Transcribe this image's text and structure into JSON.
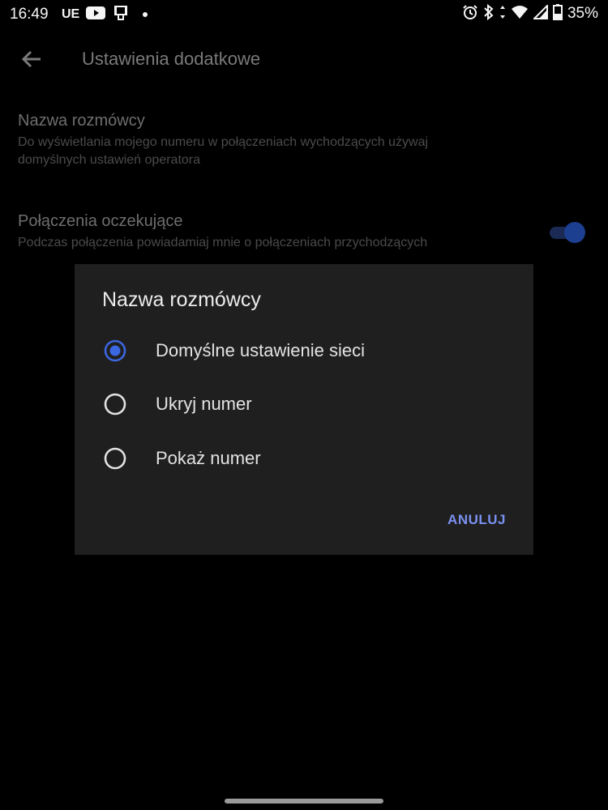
{
  "status_bar": {
    "time": "16:49",
    "carrier": "UE",
    "battery": "35%",
    "icons": [
      "youtube-icon",
      "clipboard-icon",
      "notification-dot-icon",
      "alarm-icon",
      "bluetooth-icon",
      "data-arrows-icon",
      "wifi-icon",
      "signal-icon",
      "battery-icon"
    ]
  },
  "toolbar": {
    "back_icon": "back-arrow-icon",
    "title": "Ustawienia dodatkowe"
  },
  "settings": [
    {
      "title": "Nazwa rozmówcy",
      "summary_line1": "Do wyświetlania mojego numeru w połączeniach wychodzących używaj",
      "summary_line2": "domyślnych ustawień operatora"
    },
    {
      "title": "Połączenia oczekujące",
      "summary": "Podczas połączenia powiadamiaj mnie o połączeniach przychodzących",
      "switch_on": true
    }
  ],
  "dialog": {
    "title": "Nazwa rozmówcy",
    "options": [
      {
        "label": "Domyślne ustawienie sieci",
        "selected": true
      },
      {
        "label": "Ukryj numer",
        "selected": false
      },
      {
        "label": "Pokaż numer",
        "selected": false
      }
    ],
    "cancel_label": "ANULUJ"
  },
  "colors": {
    "background": "#000000",
    "dialog_bg": "#1f1f1f",
    "accent": "#3b67e0",
    "button_text": "#7a90f0"
  }
}
